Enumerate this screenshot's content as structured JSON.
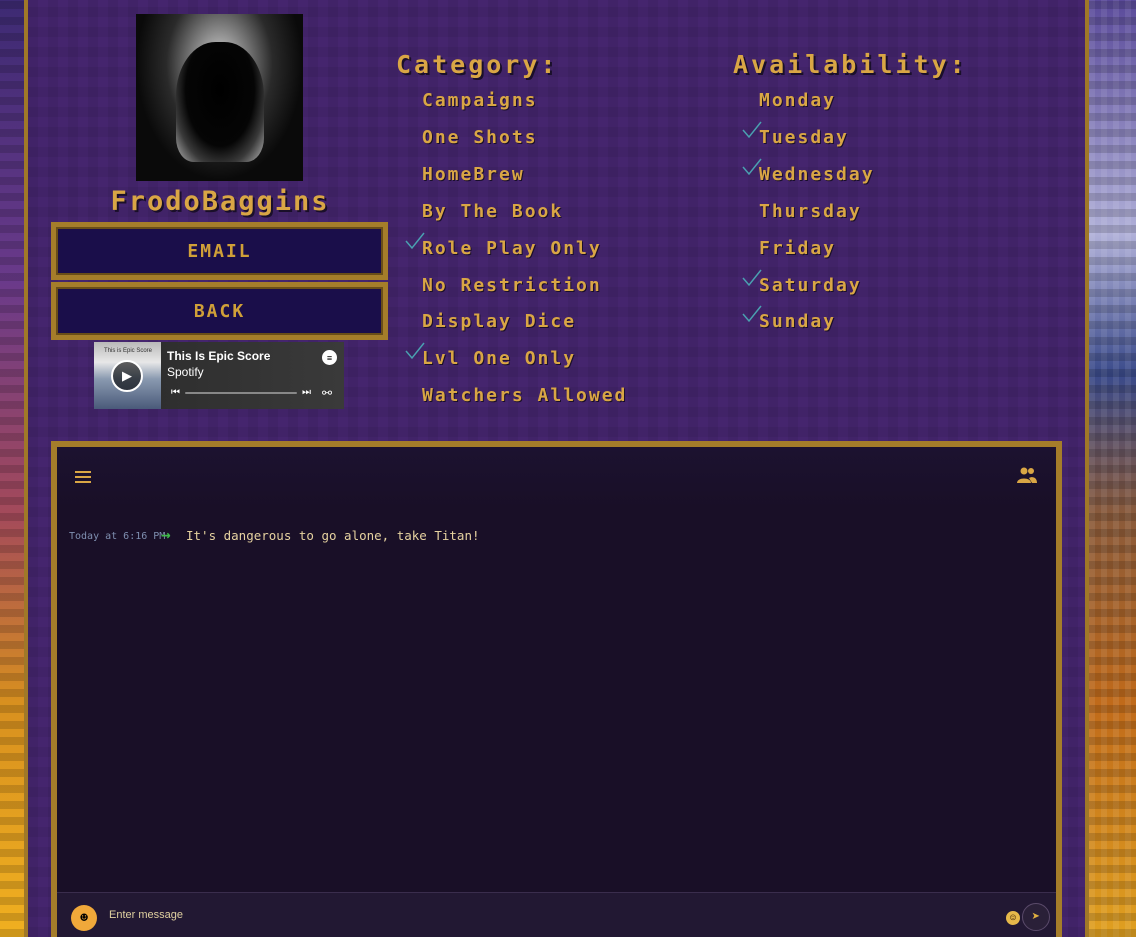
{
  "profile": {
    "username": "FrodoBaggins"
  },
  "buttons": {
    "email_label": "EMAIL",
    "back_label": "BACK"
  },
  "spotify": {
    "title": "This Is Epic Score",
    "artist": "Spotify",
    "cover_text": "This is Epic Score"
  },
  "category": {
    "heading": "Category:",
    "options": [
      {
        "label": "Campaigns",
        "checked": false
      },
      {
        "label": "One Shots",
        "checked": false
      },
      {
        "label": "HomeBrew",
        "checked": false
      },
      {
        "label": "By The Book",
        "checked": false
      },
      {
        "label": "Role Play Only",
        "checked": true
      },
      {
        "label": "No Restriction",
        "checked": false
      },
      {
        "label": "Display Dice",
        "checked": false
      },
      {
        "label": "Lvl One Only",
        "checked": true
      },
      {
        "label": "Watchers Allowed",
        "checked": false
      }
    ]
  },
  "availability": {
    "heading": "Availability:",
    "options": [
      {
        "label": "Monday",
        "checked": false
      },
      {
        "label": "Tuesday",
        "checked": true
      },
      {
        "label": "Wednesday",
        "checked": true
      },
      {
        "label": "Thursday",
        "checked": false
      },
      {
        "label": "Friday",
        "checked": false
      },
      {
        "label": "Saturday",
        "checked": true
      },
      {
        "label": "Sunday",
        "checked": true
      }
    ]
  },
  "chat": {
    "messages": [
      {
        "time": "Today at 6:16 PM",
        "text": "It's dangerous to go alone, take Titan!"
      }
    ],
    "input_placeholder": "Enter message"
  },
  "colors": {
    "gold": "#d9a645",
    "border": "#a57d2a",
    "panel_bg": "#45256e",
    "chat_bg": "#190f27",
    "check": "#4aa0b0"
  }
}
